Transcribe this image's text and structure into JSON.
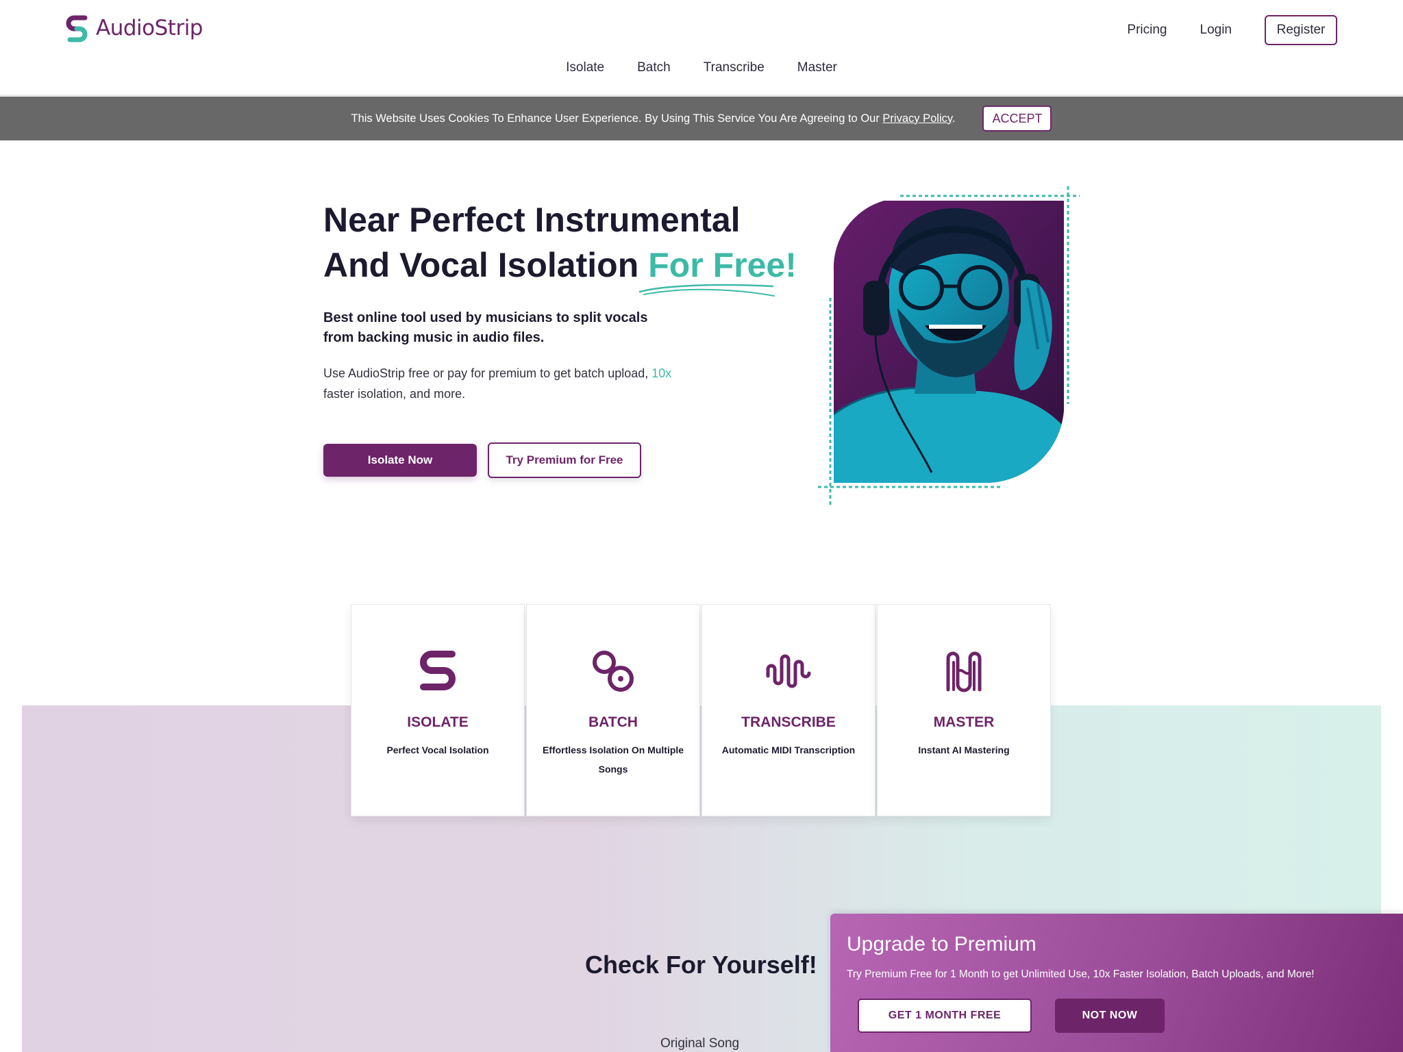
{
  "brand": {
    "name": "AudioStrip",
    "primary_color": "#6d2468",
    "accent_color": "#3dbaa7"
  },
  "top_nav": {
    "pricing": "Pricing",
    "login": "Login",
    "register": "Register"
  },
  "main_nav": [
    "Isolate",
    "Batch",
    "Transcribe",
    "Master"
  ],
  "cookie": {
    "text": "This Website Uses Cookies To Enhance User Experience. By Using This Service You Are Agreeing to Our",
    "link": "Privacy Policy",
    "period": ".",
    "accept": "ACCEPT"
  },
  "hero": {
    "title_line1": "Near Perfect Instrumental",
    "title_line2": "And Vocal Isolation",
    "title_accent": "For Free!",
    "subtitle": "Best online tool used by musicians to split vocals from backing music in audio files.",
    "body_before": "Use AudioStrip free or pay for premium to get batch upload,",
    "body_accent": "10x",
    "body_after": "faster isolation, and more.",
    "primary_button": "Isolate Now",
    "secondary_button": "Try Premium for Free",
    "image_icon": "man-with-headphones-photo"
  },
  "features": [
    {
      "icon": "isolate-s-icon",
      "title": "ISOLATE",
      "desc": "Perfect Vocal Isolation"
    },
    {
      "icon": "batch-links-icon",
      "title": "BATCH",
      "desc": "Effortless Isolation On Multiple Songs"
    },
    {
      "icon": "waveform-icon",
      "title": "TRANSCRIBE",
      "desc": "Automatic MIDI Transcription"
    },
    {
      "icon": "master-waves-icon",
      "title": "MASTER",
      "desc": "Instant AI Mastering"
    }
  ],
  "check": {
    "title": "Check For Yourself!",
    "original_song": "Original Song"
  },
  "upgrade": {
    "title": "Upgrade to Premium",
    "text": "Try Premium Free for 1 Month to get Unlimited Use, 10x Faster Isolation, Batch Uploads, and More!",
    "get_button": "GET 1 MONTH FREE",
    "not_now_button": "NOT NOW"
  }
}
